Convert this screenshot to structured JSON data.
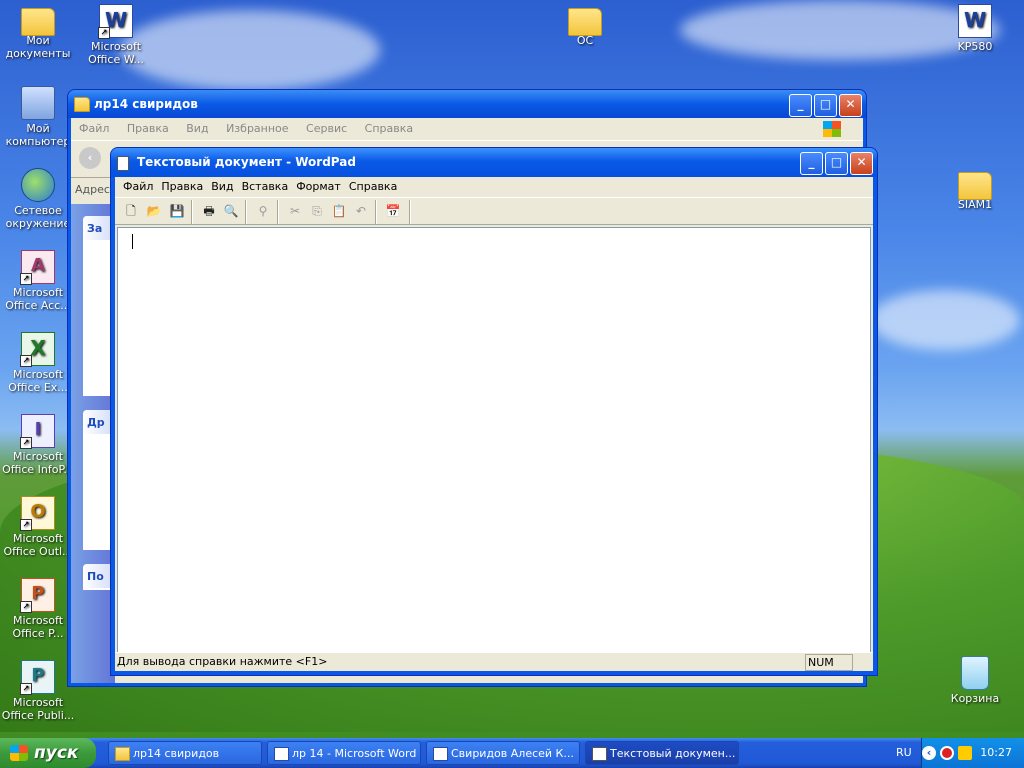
{
  "desktop": {
    "icons": [
      {
        "label": "Мои документы",
        "glyph": "folder-icon"
      },
      {
        "label": "Microsoft Office W...",
        "glyph": "word-icon"
      },
      {
        "label": "Мой компьютер",
        "glyph": "computer-icon"
      },
      {
        "label": "Сетевое окружение",
        "glyph": "network-icon"
      },
      {
        "label": "Microsoft Office Acc...",
        "glyph": "access-icon"
      },
      {
        "label": "Microsoft Office Ex...",
        "glyph": "excel-icon"
      },
      {
        "label": "Microsoft Office InfoP...",
        "glyph": "infopath-icon"
      },
      {
        "label": "Microsoft Office Outl...",
        "glyph": "outlook-icon"
      },
      {
        "label": "Microsoft Office P...",
        "glyph": "powerpoint-icon"
      },
      {
        "label": "Microsoft Office Publi...",
        "glyph": "publisher-icon"
      },
      {
        "label": "OC",
        "glyph": "folder-icon"
      },
      {
        "label": "KP580",
        "glyph": "word-doc-icon"
      },
      {
        "label": "SIAM1",
        "glyph": "folder-icon"
      },
      {
        "label": "Корзина",
        "glyph": "recycle-bin-icon"
      }
    ]
  },
  "explorer": {
    "title": "лр14 свиридов",
    "menu": [
      "Файл",
      "Правка",
      "Вид",
      "Избранное",
      "Сервис",
      "Справка"
    ],
    "address_label": "Адрес",
    "tasks_header": "За",
    "other_header": "Др",
    "details_header": "По"
  },
  "wordpad": {
    "title": "Текстовый документ - WordPad",
    "menu": [
      "Файл",
      "Правка",
      "Вид",
      "Вставка",
      "Формат",
      "Справка"
    ],
    "status": "Для вывода справки нажмите <F1>",
    "num": "NUM"
  },
  "taskbar": {
    "start": "пуск",
    "tasks": [
      {
        "label": "лр14 свиридов",
        "icon": "folder-icon"
      },
      {
        "label": "лр 14 - Microsoft Word",
        "icon": "word-icon"
      },
      {
        "label": "Свиридов Алесей К...",
        "icon": "word-icon"
      },
      {
        "label": "Текстовый докумен...",
        "icon": "wordpad-icon"
      }
    ],
    "lang": "RU",
    "clock": "10:27"
  }
}
